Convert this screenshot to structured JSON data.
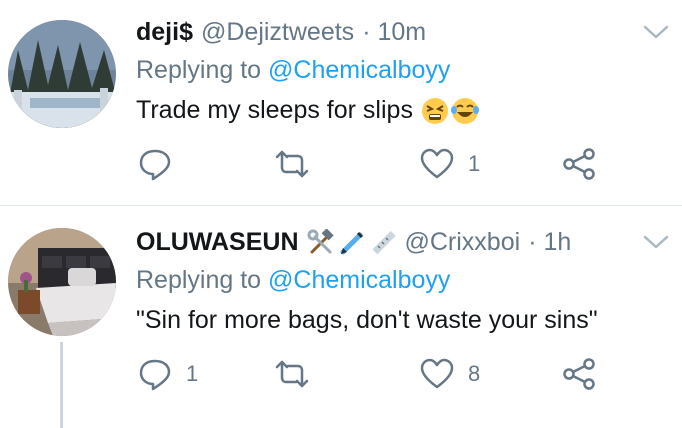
{
  "tweets": [
    {
      "display_name": "deji$",
      "handle": "@Dejiztweets",
      "time": "· 10m",
      "replying_prefix": "Replying to",
      "replying_handle": "@Chemicalboyy",
      "text": "Trade my sleeps for slips",
      "text_emojis": [
        "tired-face-emoji",
        "joy-emoji"
      ],
      "reply_count": "",
      "retweet_count": "",
      "like_count": "1"
    },
    {
      "display_name": "OLUWASEUN",
      "name_emojis": [
        "hammer-and-wrench-emoji",
        "pen-emoji",
        "ruler-emoji"
      ],
      "handle": "@Crixxboi",
      "time": "· 1h",
      "replying_prefix": "Replying to",
      "replying_handle": "@Chemicalboyy",
      "text": "\"Sin for more bags, don't waste your sins\"",
      "reply_count": "1",
      "retweet_count": "",
      "like_count": "8"
    }
  ],
  "icons": {
    "reply": "reply-icon",
    "retweet": "retweet-icon",
    "like": "heart-icon",
    "share": "share-icon",
    "menu": "chevron-down-icon"
  },
  "colors": {
    "text": "#14171a",
    "muted": "#657786",
    "link": "#1da1f2",
    "divider": "#e1e8ed"
  }
}
